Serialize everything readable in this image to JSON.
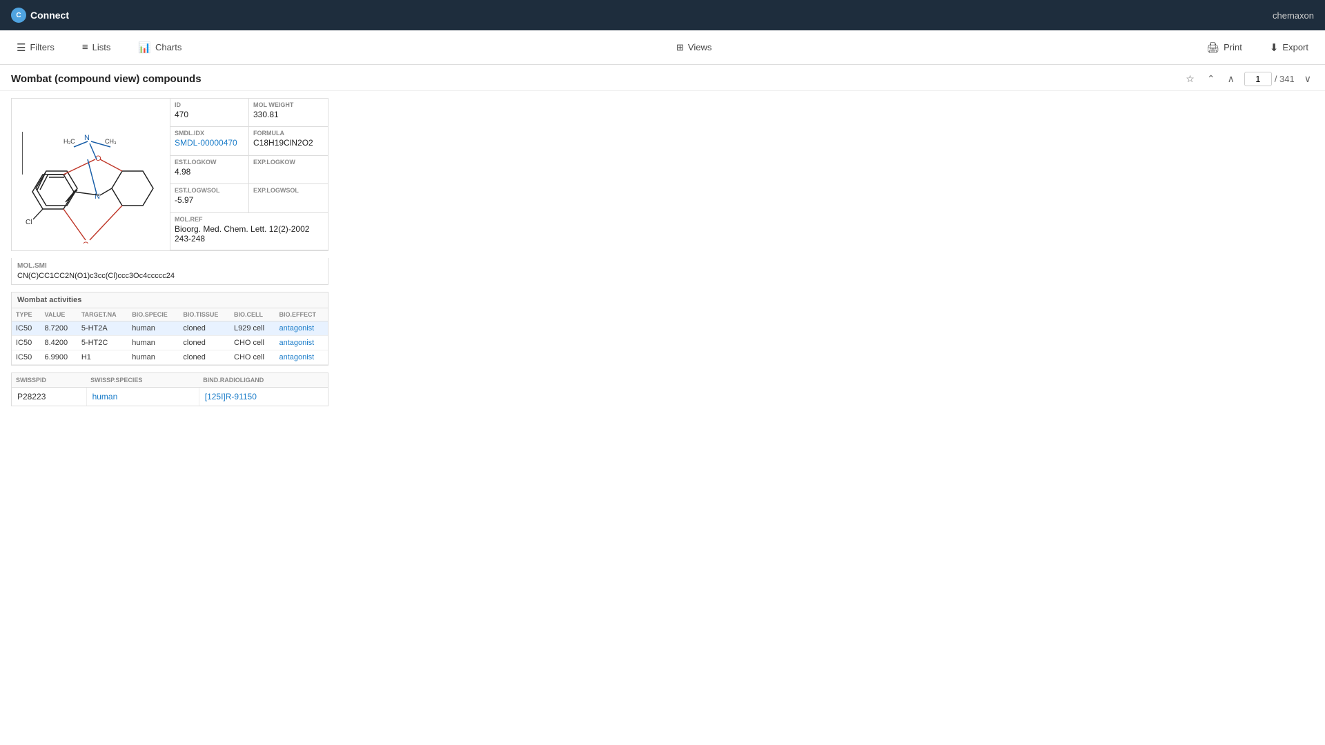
{
  "app": {
    "name": "Connect",
    "user": "chemaxon"
  },
  "toolbar": {
    "filters_label": "Filters",
    "lists_label": "Lists",
    "charts_label": "Charts",
    "views_label": "Views",
    "print_label": "Print",
    "export_label": "Export"
  },
  "page": {
    "title": "Wombat (compound view) compounds",
    "current_page": "1",
    "total_pages": "341"
  },
  "compound": {
    "fields": {
      "id_label": "ID",
      "id_value": "470",
      "mol_weight_label": "Mol Weight",
      "mol_weight_value": "330.81",
      "smdl_idx_label": "SMDL.IDX",
      "smdl_idx_value": "SMDL-00000470",
      "formula_label": "Formula",
      "formula_value": "C18H19ClN2O2",
      "est_logkow_label": "EST.LOGKOW",
      "est_logkow_value": "4.98",
      "exp_logkow_label": "EXP.LOGKOW",
      "exp_logkow_value": "",
      "est_logwsol_label": "EST.LOGWSOL",
      "est_logwsol_value": "-5.97",
      "exp_logwsol_label": "EXP.LOGWSOL",
      "exp_logwsol_value": "",
      "mol_ref_label": "MOL.REF",
      "mol_ref_value": "Bioorg. Med. Chem. Lett. 12(2)-2002 243-248"
    },
    "smiles": {
      "label": "MOL.SMI",
      "value": "CN(C)CC1CC2N(O1)c3cc(Cl)ccc3Oc4ccccc24"
    },
    "activities": {
      "section_label": "Wombat activities",
      "columns": [
        "TYPE",
        "VALUE",
        "TARGET.NA",
        "BIO.SPECIE",
        "BIO.TISSUE",
        "BIO.CELL",
        "BIO.EFFECT"
      ],
      "rows": [
        [
          "IC50",
          "8.7200",
          "5-HT2A",
          "human",
          "cloned",
          "L929 cell",
          "antagonist"
        ],
        [
          "IC50",
          "8.4200",
          "5-HT2C",
          "human",
          "cloned",
          "CHO cell",
          "antagonist"
        ],
        [
          "IC50",
          "6.9900",
          "H1",
          "human",
          "cloned",
          "CHO cell",
          "antagonist"
        ]
      ]
    },
    "swiss": {
      "columns": [
        "SWISSPID",
        "SWISSP.SPECIES",
        "BIND.RADIOLIGAND"
      ],
      "rows": [
        [
          "P28223",
          "human",
          "[125I]R-91150"
        ]
      ]
    }
  }
}
